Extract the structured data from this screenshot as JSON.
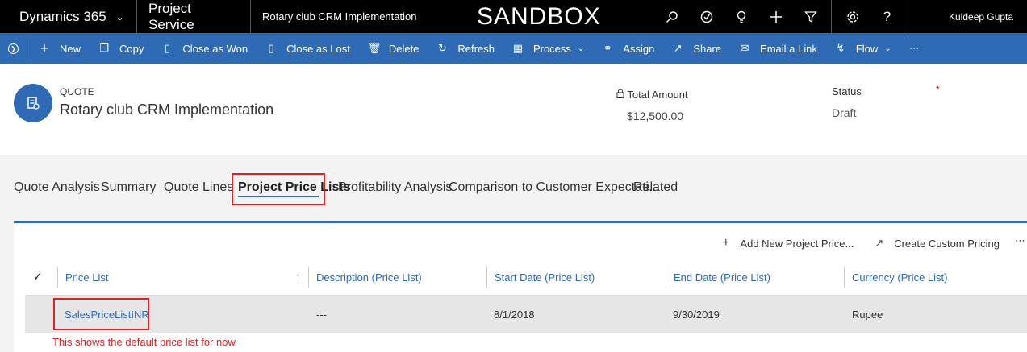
{
  "topbar": {
    "app_name": "Dynamics 365",
    "module": "Project Service",
    "record": "Rotary club CRM Implementation",
    "environment": "SANDBOX",
    "user": "Kuldeep Gupta"
  },
  "commands": [
    {
      "label": "New",
      "icon": "plus-icon"
    },
    {
      "label": "Copy",
      "icon": "copy-icon"
    },
    {
      "label": "Close as Won",
      "icon": "close-won-icon"
    },
    {
      "label": "Close as Lost",
      "icon": "close-lost-icon"
    },
    {
      "label": "Delete",
      "icon": "delete-icon"
    },
    {
      "label": "Refresh",
      "icon": "refresh-icon"
    },
    {
      "label": "Process",
      "icon": "process-icon"
    },
    {
      "label": "Assign",
      "icon": "assign-icon"
    },
    {
      "label": "Share",
      "icon": "share-icon"
    },
    {
      "label": "Email a Link",
      "icon": "email-icon"
    },
    {
      "label": "Flow",
      "icon": "flow-icon"
    }
  ],
  "header": {
    "entity": "QUOTE",
    "title": "Rotary club CRM Implementation",
    "total_label": "Total Amount",
    "total_value": "$12,500.00",
    "status_label": "Status",
    "status_required": "*",
    "status_value": "Draft"
  },
  "tabs": [
    "Quote Analysis",
    "Summary",
    "Quote Lines",
    "Project Price Lists",
    "Profitability Analysis",
    "Comparison to Customer Expectati...",
    "Related"
  ],
  "active_tab": "Project Price Lists",
  "subgrid": {
    "add_label": "Add New Project Price...",
    "custom_label": "Create Custom Pricing",
    "columns": [
      "Price List",
      "Description (Price List)",
      "Start Date (Price List)",
      "End Date (Price List)",
      "Currency (Price List)"
    ],
    "rows": [
      {
        "price_list": "SalesPriceListINR",
        "description": "---",
        "start": "8/1/2018",
        "end": "9/30/2019",
        "currency": "Rupee"
      }
    ]
  },
  "note": "This shows the default price list for now",
  "colors": {
    "accent": "#2f6bb5",
    "highlight": "#dd2222"
  }
}
